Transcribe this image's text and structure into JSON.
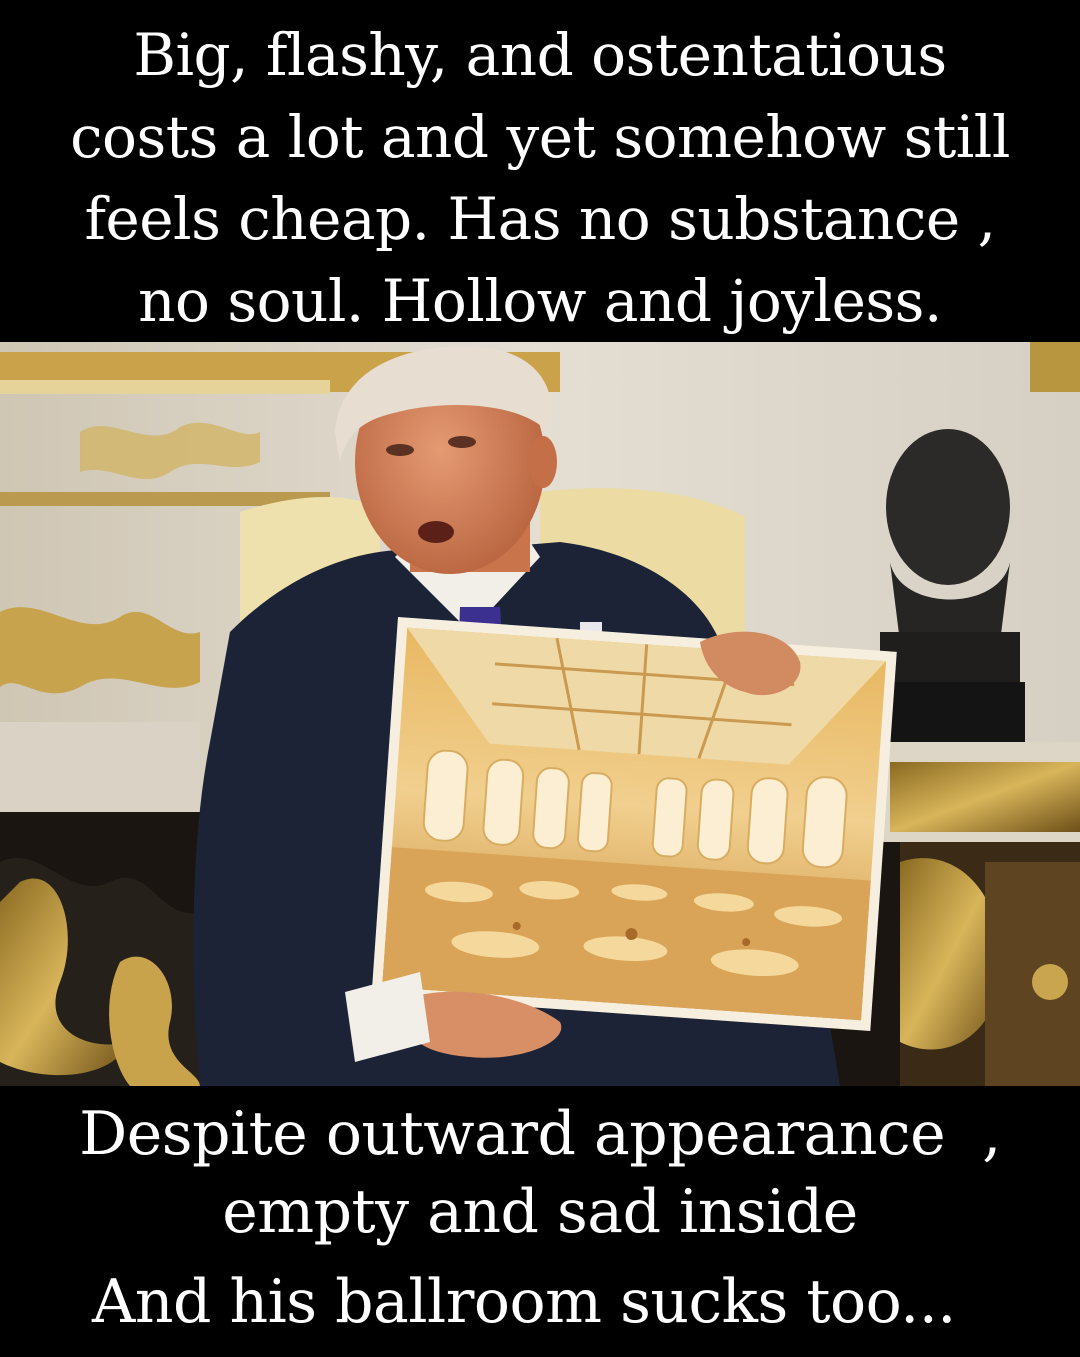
{
  "caption_top": {
    "lines": [
      "Big, flashy, and ostentatious",
      "costs a lot and yet somehow still",
      "feels cheap. Has no substance  ,",
      "no soul.  Hollow and joyless."
    ]
  },
  "caption_bottom": {
    "line1": "Despite outward appearance  ,",
    "line2": "empty and sad inside",
    "line3": "And his ballroom sucks too..."
  },
  "colors": {
    "background": "#000000",
    "text": "#ffffff",
    "gold": "#c9a24a",
    "wall": "#d8d2c6",
    "suit": "#1d2336"
  }
}
